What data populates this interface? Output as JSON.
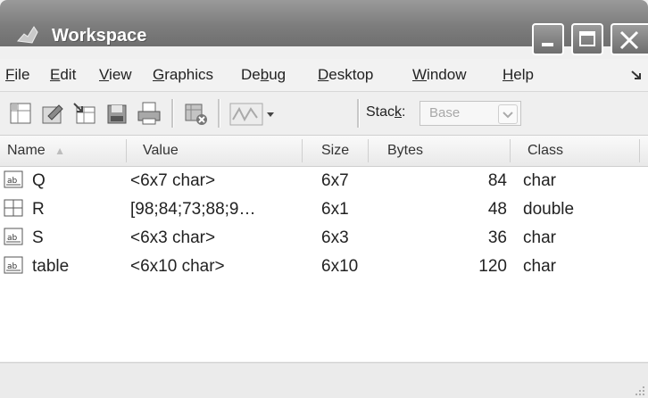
{
  "window": {
    "title": "Workspace"
  },
  "menu": [
    {
      "label": "File",
      "mnemonic": "F",
      "rest": "ile"
    },
    {
      "label": "Edit",
      "mnemonic": "E",
      "rest": "dit"
    },
    {
      "label": "View",
      "mnemonic": "V",
      "rest": "iew"
    },
    {
      "label": "Graphics",
      "mnemonic": "G",
      "rest": "raphics"
    },
    {
      "label": "Debug",
      "pre": "De",
      "mnemonic": "b",
      "rest": "ug"
    },
    {
      "label": "Desktop",
      "mnemonic": "D",
      "rest": "esktop"
    },
    {
      "label": "Window",
      "mnemonic": "W",
      "rest": "indow"
    },
    {
      "label": "Help",
      "mnemonic": "H",
      "rest": "elp"
    }
  ],
  "toolbar": {
    "stack_label_pre": "Stac",
    "stack_label_mnemonic": "k",
    "stack_label_post": ":",
    "stack_value": "Base"
  },
  "table": {
    "columns": [
      "Name",
      "Value",
      "Size",
      "Bytes",
      "Class"
    ],
    "sort_indicator": "▲",
    "rows": [
      {
        "icon": "char-array-icon",
        "name": "Q",
        "value": "<6x7 char>",
        "size": "6x7",
        "bytes": "84",
        "class": "char"
      },
      {
        "icon": "numeric-array-icon",
        "name": "R",
        "value": "[98;84;73;88;9…",
        "size": "6x1",
        "bytes": "48",
        "class": "double"
      },
      {
        "icon": "char-array-icon",
        "name": "S",
        "value": "<6x3 char>",
        "size": "6x3",
        "bytes": "36",
        "class": "char"
      },
      {
        "icon": "char-array-icon",
        "name": "table",
        "value": "<6x10 char>",
        "size": "6x10",
        "bytes": "120",
        "class": "char"
      }
    ]
  },
  "icons": {
    "title": "matlab-logo-icon",
    "minimize": "minimize-icon",
    "maximize": "maximize-icon",
    "close": "close-icon"
  }
}
